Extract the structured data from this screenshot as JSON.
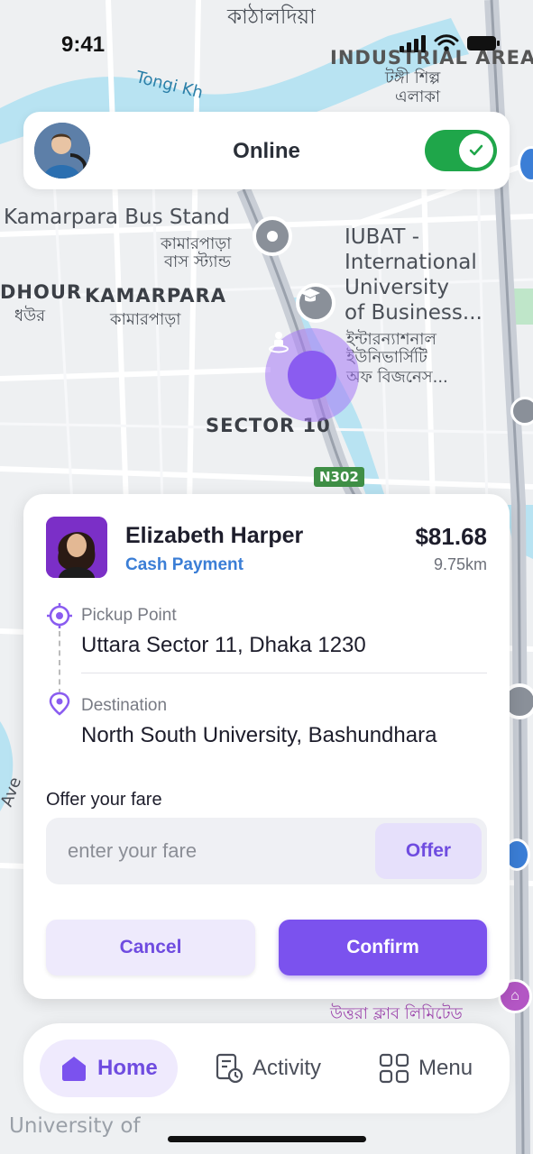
{
  "status_bar": {
    "time": "9:41"
  },
  "map": {
    "labels": {
      "kathaldia": "কাঠালদিয়া",
      "industrial_area": "INDUSTRIAL AREA",
      "tongi_shilpa": "টঙ্গী শিল্প",
      "elaka": "এলাকা",
      "tongi_khal": "Tongi Kh",
      "kamarpara_bus_stand": "Kamarpara Bus Stand",
      "kamarpara_bus_bn1": "কামারপাড়া",
      "kamarpara_bus_bn2": "বাস স্ট্যান্ড",
      "iubat_1": "IUBAT -",
      "iubat_2": "International",
      "iubat_3": "University",
      "iubat_4": "of Business...",
      "iubat_bn1": "ইন্টারন্যাশনাল",
      "iubat_bn2": "ইউনিভার্সিটি",
      "iubat_bn3": "অফ বিজনেস...",
      "dhour": "DHOUR",
      "dhour_bn": "ধউর",
      "kamarpara": "KAMARPARA",
      "kamarpara_bn": "কামারপাড়া",
      "sector_10": "SECTOR 10",
      "road_shield": "N302",
      "uttara_club": "উত্তরা ক্লাব লিমিটেড",
      "university_of": "University of",
      "ave": "Ave"
    }
  },
  "online_card": {
    "status_label": "Online",
    "toggle_on": true
  },
  "ride": {
    "rider_name": "Elizabeth Harper",
    "payment_method": "Cash Payment",
    "fare": "$81.68",
    "distance": "9.75km",
    "pickup_label": "Pickup Point",
    "pickup_value": "Uttara Sector 11, Dhaka 1230",
    "destination_label": "Destination",
    "destination_value": "North South University, Bashundhara",
    "offer_title": "Offer your fare",
    "fare_placeholder": "enter your fare",
    "offer_button": "Offer",
    "cancel_button": "Cancel",
    "confirm_button": "Confirm"
  },
  "nav": {
    "home": "Home",
    "activity": "Activity",
    "menu": "Menu"
  },
  "colors": {
    "accent": "#7b52ee",
    "toggle_green": "#1fa64a",
    "payment_blue": "#3b7ed6"
  }
}
